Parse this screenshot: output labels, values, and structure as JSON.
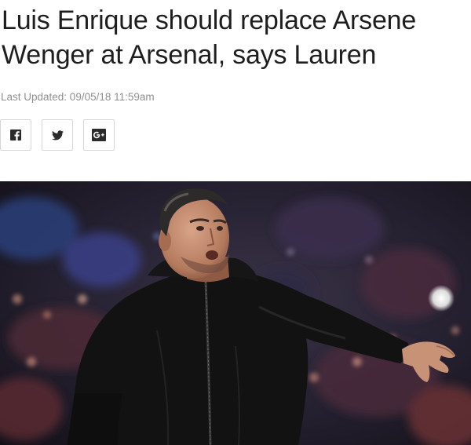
{
  "article": {
    "headline": "Luis Enrique should replace Arsene Wenger at Arsenal, says Lauren",
    "last_updated": "Last Updated: 09/05/18 11:59am"
  },
  "share": {
    "buttons": [
      {
        "network": "facebook",
        "icon": "facebook-icon"
      },
      {
        "network": "twitter",
        "icon": "twitter-icon"
      },
      {
        "network": "google-plus",
        "icon": "google-plus-icon"
      }
    ]
  },
  "hero_image": {
    "subject": "man in black hooded jacket gesturing on touchline, blurred stadium crowd behind"
  },
  "colors": {
    "headline": "#1e1e1e",
    "timestamp": "#8f8f8f",
    "icon": "#2b2b2b",
    "button_border": "#d6d6d6",
    "jacket": "#121212"
  }
}
